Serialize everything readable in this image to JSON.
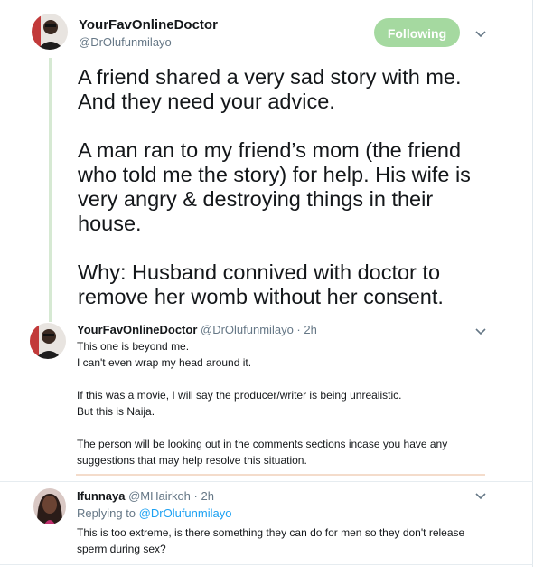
{
  "main_tweet": {
    "display_name": "YourFavOnlineDoctor",
    "handle": "@DrOlufunmilayo",
    "follow_label": "Following",
    "paragraphs": [
      "A friend shared a very sad story with me. And they need your advice.",
      "A man ran to my friend’s mom (the friend who told me the story) for help. His wife is very angry & destroying things in their house.",
      "Why: Husband connived with doctor to remove her womb without her consent."
    ]
  },
  "reply_1": {
    "display_name": "YourFavOnlineDoctor",
    "meta": "@DrOlufunmilayo · 2h",
    "paragraphs": [
      "This one is beyond me.\nI can't even wrap my head around it.",
      "If this was a movie, I will say the producer/writer is being unrealistic.\nBut this is Naija.",
      "The person will be looking out in the comments sections incase you have any suggestions that may help resolve this situation."
    ]
  },
  "reply_2": {
    "display_name": "Ifunnaya",
    "meta": "@MHairkoh · 2h",
    "replying_prefix": "Replying to",
    "replying_to": "@DrOlufunmilayo",
    "text": "This is too extreme, is there something they can do for men so they don't release sperm during sex?"
  },
  "colors": {
    "follow_button": "#a5d9a0",
    "thread_line": "#d6e9d3",
    "link": "#1da1f2",
    "muted": "#657786"
  },
  "icons": [
    "chevron-down-icon",
    "avatar"
  ]
}
